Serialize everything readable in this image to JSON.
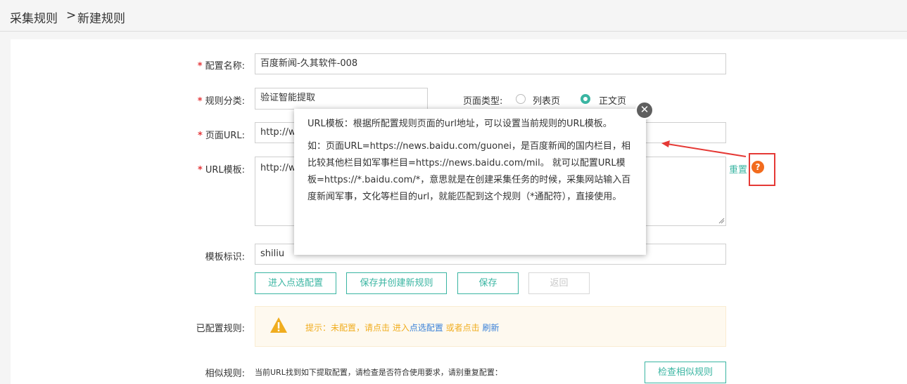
{
  "breadcrumb": {
    "root": "采集规则",
    "separator": ">",
    "current": "新建规则"
  },
  "form": {
    "config_name": {
      "label": "配置名称:",
      "value": "百度新闻-久其软件-008"
    },
    "rule_category": {
      "label": "规则分类:",
      "value": "验证智能提取"
    },
    "page_type": {
      "label": "页面类型:",
      "options": [
        "列表页",
        "正文页"
      ],
      "selected": "正文页"
    },
    "page_url": {
      "label": "页面URL:",
      "value": "http://w"
    },
    "url_template": {
      "label": "URL模板:",
      "value": "http://w",
      "reset_label": "重置"
    },
    "template_tag": {
      "label": "模板标识:",
      "value": "shiliu"
    }
  },
  "buttons": {
    "enter_select": "进入点选配置",
    "save_and_new": "保存并创建新规则",
    "save": "保存",
    "back": "返回"
  },
  "configured": {
    "label": "已配置规则:",
    "hint_prefix": "提示：未配置，请点击 进入",
    "hint_link1": "点选配置",
    "hint_mid": " 或者点击 ",
    "hint_link2": "刷新"
  },
  "similar": {
    "label": "相似规则:",
    "text": "当前URL找到如下提取配置，请检查是否符合使用要求，请别重复配置：",
    "button": "检查相似规则"
  },
  "tooltip": {
    "para1": "URL模板：根据所配置规则页面的url地址，可以设置当前规则的URL模板。",
    "para2": "如：页面URL=https://news.baidu.com/guonei，是百度新闻的国内栏目，相比较其他栏目如军事栏目=https://news.baidu.com/mil。 就可以配置URL模板=https://*.baidu.com/*，意思就是在创建采集任务的时候，采集网站输入百度新闻军事，文化等栏目的url，就能匹配到这个规则（*通配符），直接使用。",
    "close": "✕"
  },
  "help_icon": "?",
  "colors": {
    "accent": "#3ab5a2",
    "required": "#e4393c",
    "warning": "#f0ad1f",
    "link": "#3b82d8",
    "annotation": "#e53935"
  }
}
